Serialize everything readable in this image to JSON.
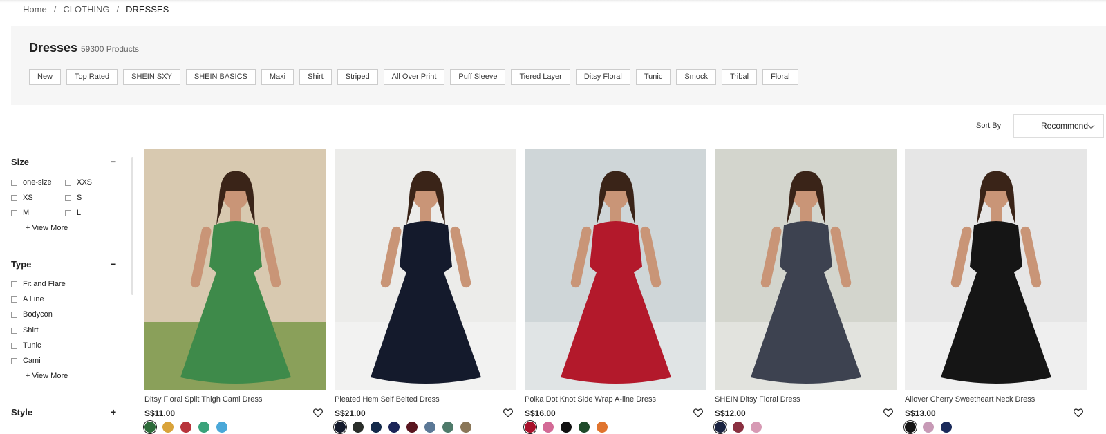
{
  "breadcrumb": [
    "Home",
    "CLOTHING",
    "DRESSES"
  ],
  "page": {
    "title": "Dresses",
    "count": "59300 Products"
  },
  "chips": [
    "New",
    "Top Rated",
    "SHEIN SXY",
    "SHEIN BASICS",
    "Maxi",
    "Shirt",
    "Striped",
    "All Over Print",
    "Puff Sleeve",
    "Tiered Layer",
    "Ditsy Floral",
    "Tunic",
    "Smock",
    "Tribal",
    "Floral"
  ],
  "sort": {
    "label": "Sort By",
    "value": "Recommend"
  },
  "filters": {
    "size": {
      "title": "Size",
      "toggle": "−",
      "options": [
        "one-size",
        "XXS",
        "XS",
        "S",
        "M",
        "L"
      ],
      "view_more": "+ View More"
    },
    "type": {
      "title": "Type",
      "toggle": "−",
      "options": [
        "Fit and Flare",
        "A Line",
        "Bodycon",
        "Shirt",
        "Tunic",
        "Cami"
      ],
      "view_more": "+ View More"
    },
    "style": {
      "title": "Style",
      "toggle": "+"
    }
  },
  "products": [
    {
      "name": "Ditsy Floral Split Thigh Cami Dress",
      "price": "S$11.00",
      "dress_color": "#3e8a4a",
      "swatches": [
        "#2d6b3a",
        "#d9a33a",
        "#b8343b",
        "#3aa27a",
        "#4aa8d8"
      ]
    },
    {
      "name": "Pleated Hem Self Belted Dress",
      "price": "S$21.00",
      "dress_color": "#141a2c",
      "swatches": [
        "#141a2c",
        "#2a2e2a",
        "#142a4a",
        "#1c2558",
        "#5a1620",
        "#5b7896",
        "#4e7a6a",
        "#8a7658"
      ]
    },
    {
      "name": "Polka Dot Knot Side Wrap A-line Dress",
      "price": "S$16.00",
      "dress_color": "#b3192b",
      "swatches": [
        "#a8102a",
        "#d36a96",
        "#111111",
        "#1f4a2a",
        "#e0742e"
      ]
    },
    {
      "name": "SHEIN Ditsy Floral Dress",
      "price": "S$12.00",
      "dress_color": "#3d4250",
      "swatches": [
        "#1a2340",
        "#8a3040",
        "#d79ab4"
      ]
    },
    {
      "name": "Allover Cherry Sweetheart Neck Dress",
      "price": "S$13.00",
      "dress_color": "#151515",
      "swatches": [
        "#151515",
        "#c79ab6",
        "#1a2a5a"
      ]
    }
  ]
}
